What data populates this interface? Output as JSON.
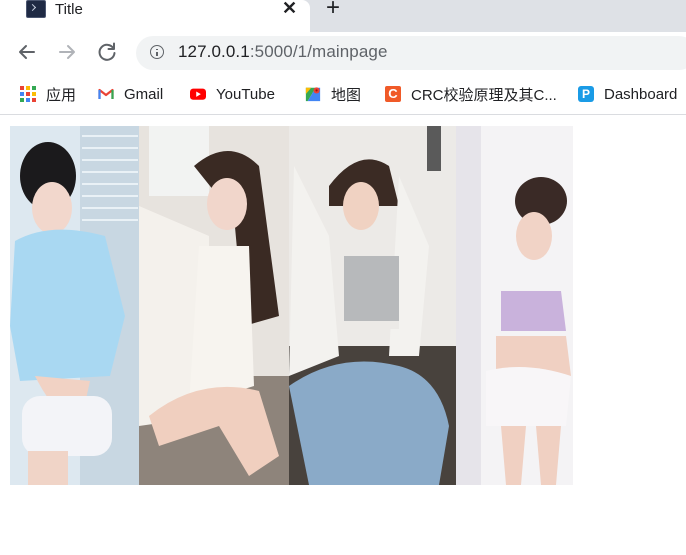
{
  "tab": {
    "title": "Title"
  },
  "address_bar": {
    "host": "127.0.0.1",
    "path": ":5000/1/mainpage"
  },
  "bookmarks": [
    {
      "label": "应用",
      "icon": "apps-grid-icon"
    },
    {
      "label": "Gmail",
      "icon": "gmail-icon"
    },
    {
      "label": "YouTube",
      "icon": "youtube-icon"
    },
    {
      "label": "地图",
      "icon": "maps-icon"
    },
    {
      "label": "CRC校验原理及其C...",
      "icon": "crc-icon"
    },
    {
      "label": "Dashboard",
      "icon": "dashboard-icon"
    }
  ],
  "colors": {
    "tabstrip": "#dee1e6",
    "omnibox": "#f1f3f4",
    "youtube_red": "#ff0000",
    "crc_orange": "#f05a28",
    "dashboard_blue": "#1a9be6"
  },
  "photos": [
    {
      "name": "girl-in-blue-hoodie"
    },
    {
      "name": "girl-in-white-shirt-sitting"
    },
    {
      "name": "girl-in-jeans-arms-up"
    },
    {
      "name": "girl-in-lilac-top-by-window"
    }
  ]
}
